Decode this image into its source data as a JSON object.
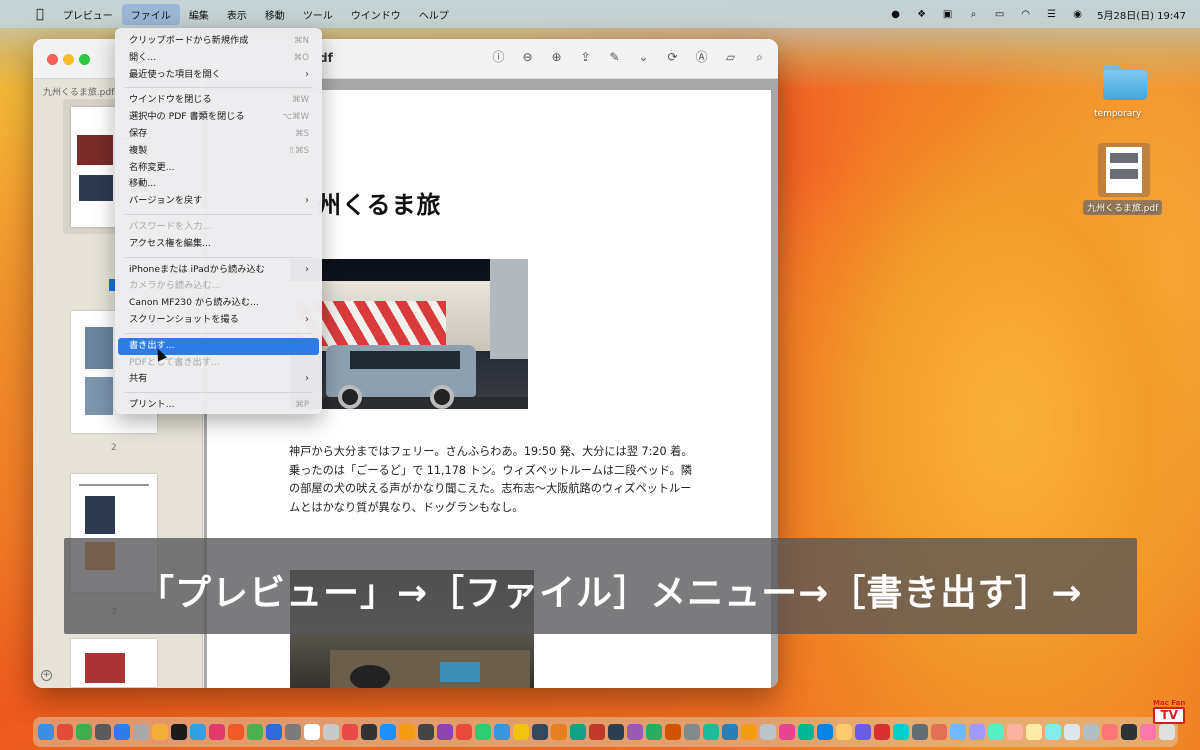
{
  "menubar": {
    "apple": "",
    "items": [
      "プレビュー",
      "ファイル",
      "編集",
      "表示",
      "移動",
      "ツール",
      "ウインドウ",
      "ヘルプ"
    ],
    "active_index": 1,
    "clock": "5月28日(日)  19:47"
  },
  "window": {
    "title": "df",
    "sidebar_title": "九州くるま旅.pdf",
    "page_numbers": [
      "2",
      "3"
    ],
    "document": {
      "title": "州くるま旅",
      "paragraph": "神戸から大分まではフェリー。さんふらわあ。19:50 発、大分には翌 7:20 着。乗ったのは「ごーるど」で 11,178 トン。ウィズペットルームは二段ベッド。隣の部屋の犬の吠える声がかなり聞こえた。志布志～大阪航路のウィズペットルームとはかなり質が異なり、ドッグランもなし。"
    }
  },
  "file_menu": {
    "groups": [
      [
        {
          "label": "クリップボードから新規作成",
          "shortcut": "⌘N"
        },
        {
          "label": "開く...",
          "shortcut": "⌘O"
        },
        {
          "label": "最近使った項目を開く",
          "submenu": true
        }
      ],
      [
        {
          "label": "ウインドウを閉じる",
          "shortcut": "⌘W"
        },
        {
          "label": "選択中の PDF 書類を閉じる",
          "shortcut": "⌥⌘W"
        },
        {
          "label": "保存",
          "shortcut": "⌘S"
        },
        {
          "label": "複製",
          "shortcut": "⇧⌘S"
        },
        {
          "label": "名称変更..."
        },
        {
          "label": "移動..."
        },
        {
          "label": "バージョンを戻す",
          "submenu": true
        }
      ],
      [
        {
          "label": "パスワードを入力...",
          "disabled": true
        },
        {
          "label": "アクセス権を編集..."
        }
      ],
      [
        {
          "label": "iPhoneまたは iPadから読み込む",
          "submenu": true
        },
        {
          "label": "カメラから読み込む...",
          "disabled": true
        },
        {
          "label": "Canon MF230 から読み込む..."
        },
        {
          "label": "スクリーンショットを撮る",
          "submenu": true
        }
      ],
      [
        {
          "label": "書き出す...",
          "highlighted": true
        },
        {
          "label": "PDFとして書き出す...",
          "disabled": true
        },
        {
          "label": "共有",
          "submenu": true
        }
      ],
      [
        {
          "label": "プリント...",
          "shortcut": "⌘P"
        }
      ]
    ]
  },
  "desktop": {
    "folder_label": "temporary",
    "file_label": "九州くるま旅.pdf"
  },
  "caption": "「プレビュー」→［ファイル］メニュー→［書き出す］→",
  "brand": {
    "top": "Mac Fan",
    "mark": "TV"
  },
  "colors": {
    "accent": "#2f7bea",
    "selection": "#1f6fe0"
  }
}
